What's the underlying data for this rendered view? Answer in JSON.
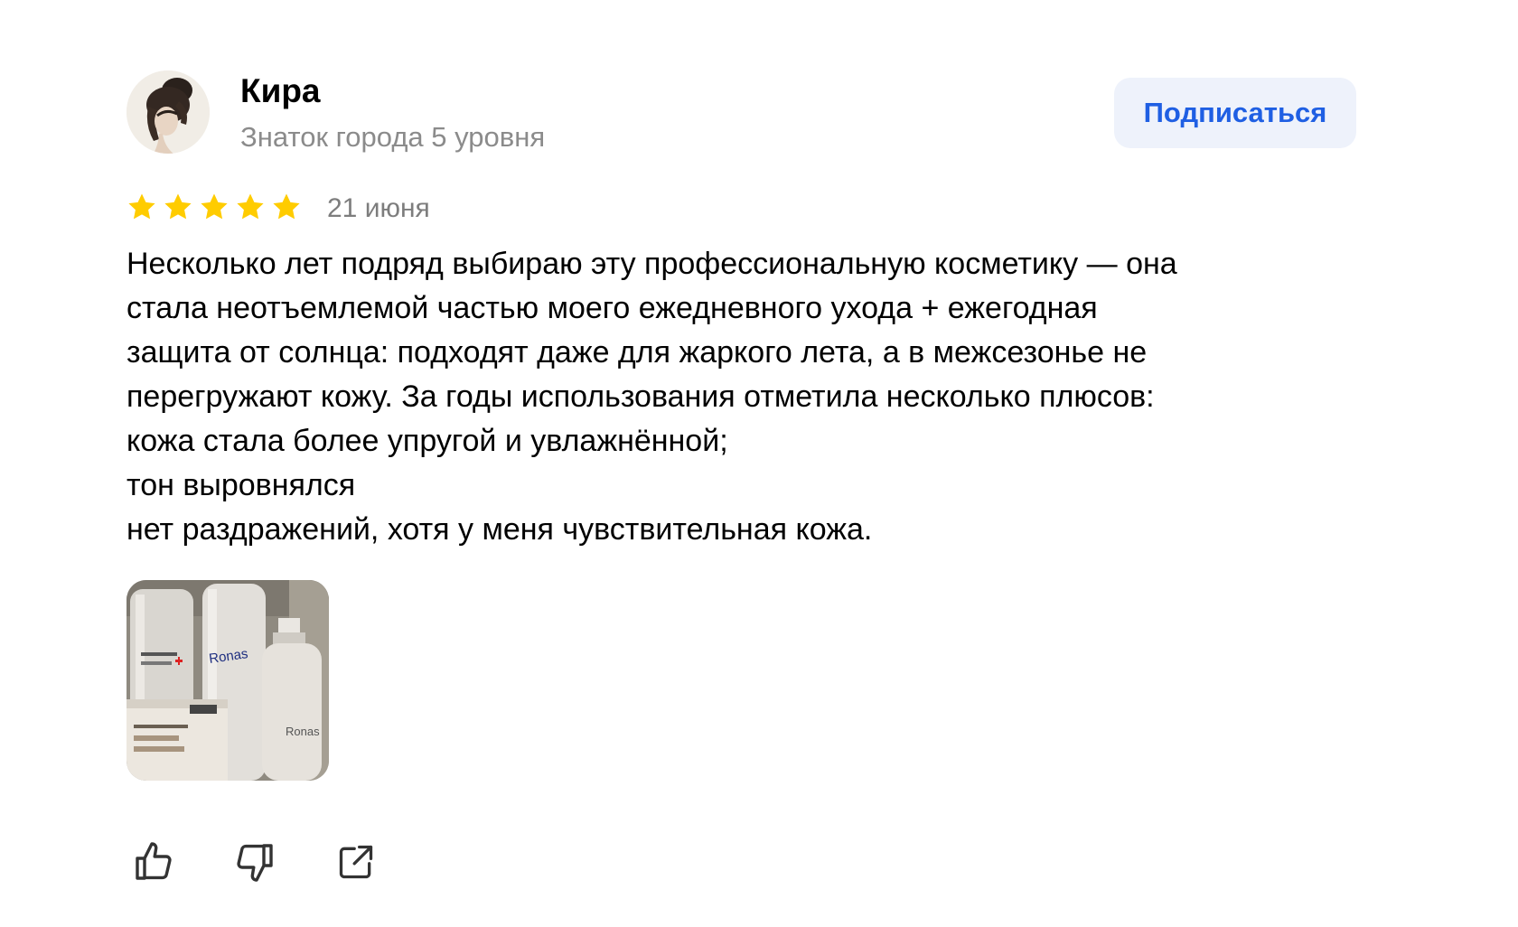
{
  "author": {
    "name": "Кира",
    "level": "Знаток города 5 уровня",
    "avatar_icon": "woman-portrait-avatar"
  },
  "subscribe_label": "Подписаться",
  "review": {
    "rating": 5,
    "rating_max": 5,
    "date": "21 июня",
    "text_lines": [
      "Несколько лет подряд выбираю эту профессиональную косметику — она",
      "стала неотъемлемой частью моего ежедневного ухода + ежегодная",
      "защита от солнца: подходят даже для жаркого лета, а в межсезонье не",
      "перегружают кожу. За годы использования отметила несколько плюсов:",
      "кожа стала более упругой и увлажнённой;",
      "тон выровнялся",
      "нет раздражений, хотя у меня чувствительная кожа."
    ],
    "photo_icon": "cosmetics-bottles-photo"
  },
  "actions": {
    "like_icon": "thumbs-up-icon",
    "dislike_icon": "thumbs-down-icon",
    "share_icon": "share-icon"
  },
  "colors": {
    "star": "#ffcc00",
    "subscribe_bg": "#eef2fb",
    "subscribe_text": "#1f5fe3",
    "secondary_text": "#8b8b8b"
  }
}
